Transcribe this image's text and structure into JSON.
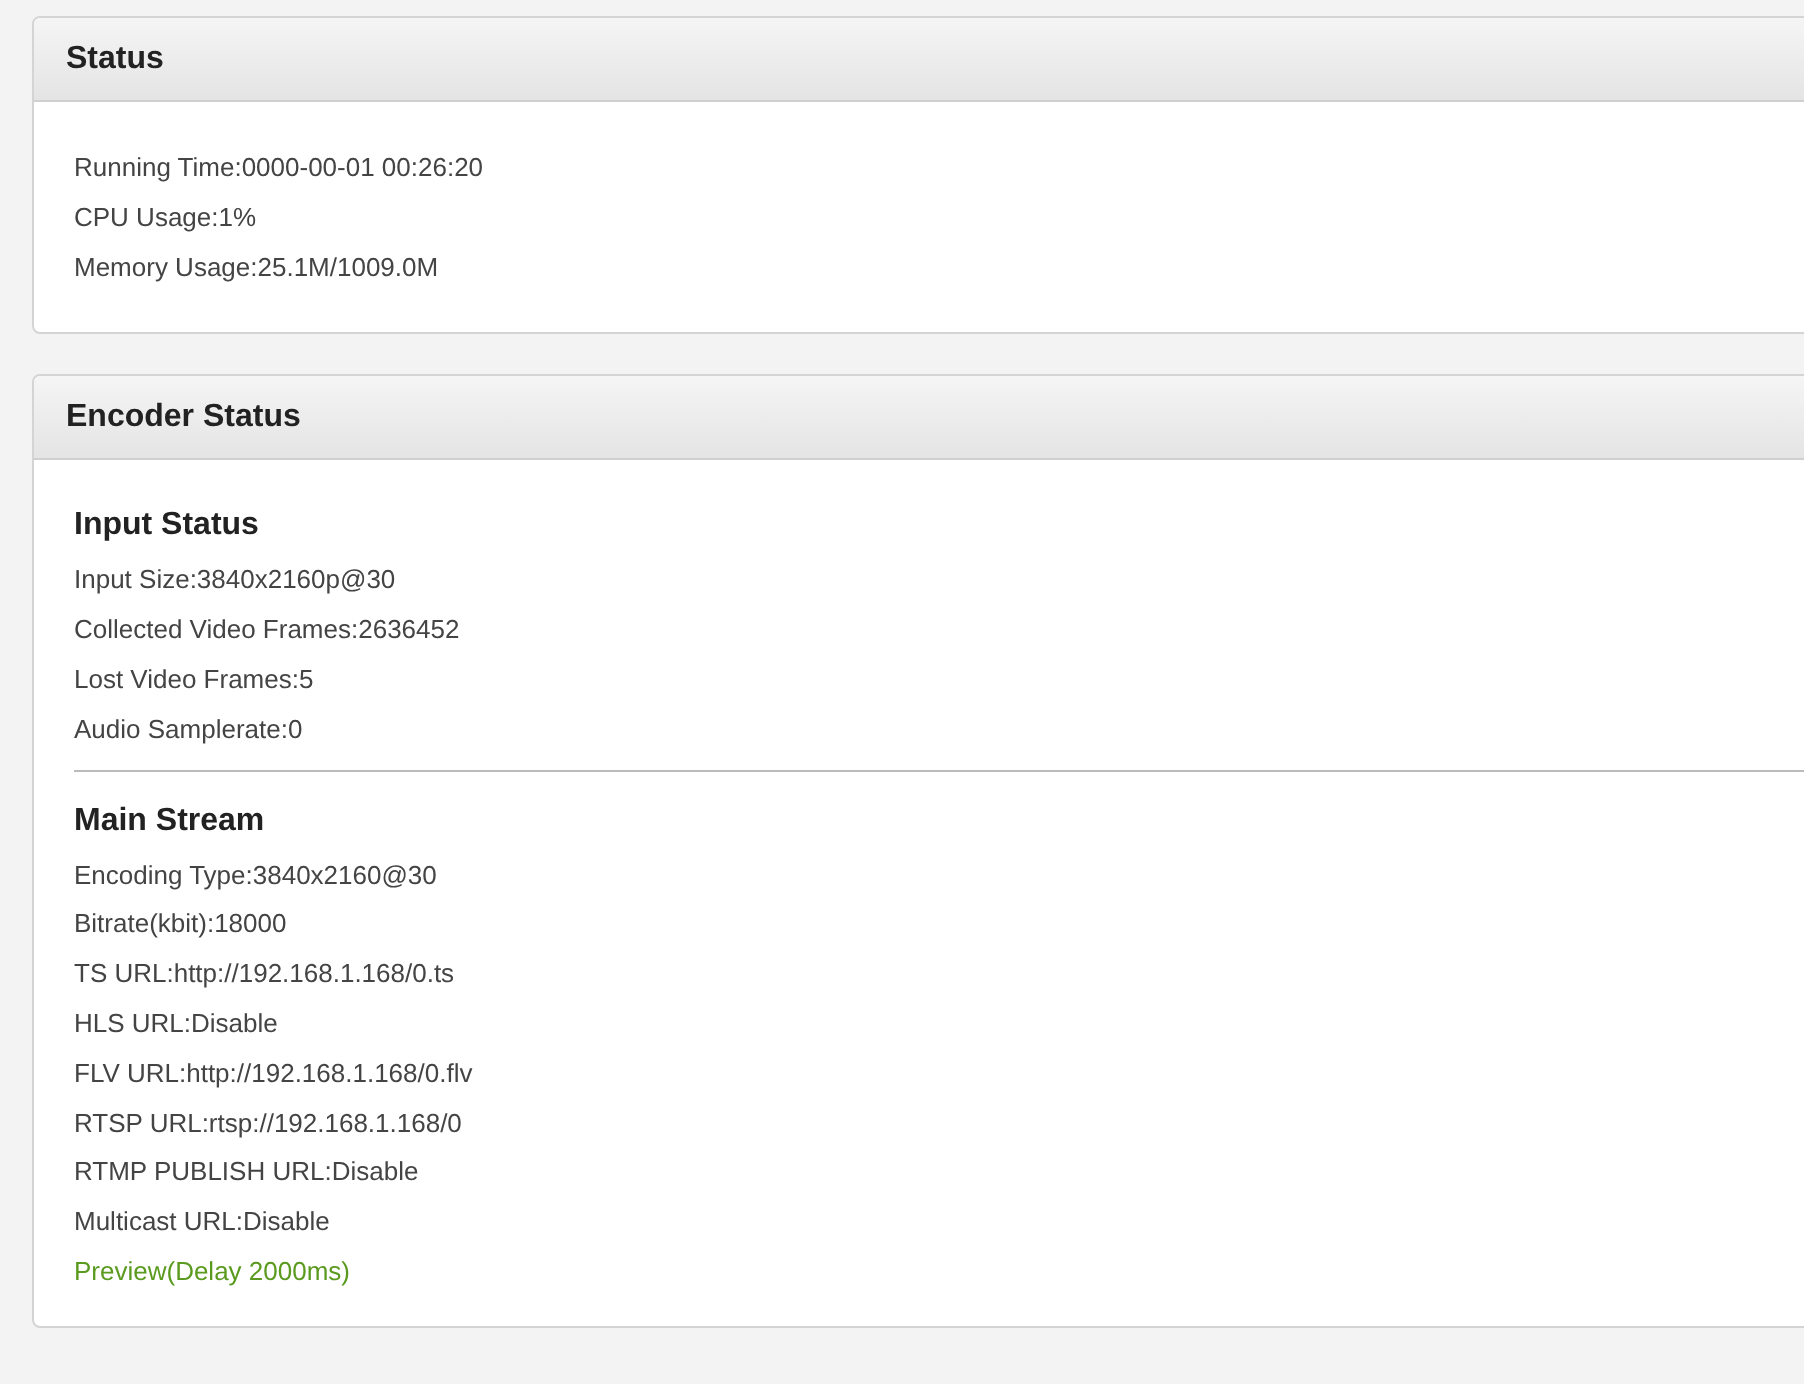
{
  "panels": [
    {
      "title": "Status",
      "sections": [
        {
          "lines": [
            {
              "kind": "text",
              "text": "Running Time:0000-00-01 00:26:20"
            },
            {
              "kind": "text",
              "text": "CPU Usage:1%"
            },
            {
              "kind": "text",
              "text": "Memory Usage:25.1M/1009.0M"
            }
          ]
        }
      ]
    },
    {
      "title": "Encoder Status",
      "sections": [
        {
          "heading": "Input Status",
          "lines": [
            {
              "kind": "text",
              "text": "Input Size:3840x2160p@30"
            },
            {
              "kind": "text",
              "text": "Collected Video Frames:2636452"
            },
            {
              "kind": "text",
              "text": "Lost Video Frames:5"
            },
            {
              "kind": "text",
              "text": "Audio Samplerate:0"
            }
          ]
        },
        {
          "heading": "Main Stream",
          "lines": [
            {
              "kind": "text",
              "text": "Encoding Type:3840x2160@30"
            },
            {
              "kind": "text",
              "text": "Bitrate(kbit):18000"
            },
            {
              "kind": "text",
              "text": "TS URL:http://192.168.1.168/0.ts"
            },
            {
              "kind": "text",
              "text": "HLS URL:Disable"
            },
            {
              "kind": "text",
              "text": "FLV URL:http://192.168.1.168/0.flv"
            },
            {
              "kind": "text",
              "text": "RTSP URL:rtsp://192.168.1.168/0"
            },
            {
              "kind": "text",
              "text": "RTMP PUBLISH URL:Disable"
            },
            {
              "kind": "text",
              "text": "Multicast URL:Disable"
            },
            {
              "kind": "link",
              "text": "Preview(Delay 2000ms)"
            }
          ]
        }
      ]
    }
  ]
}
